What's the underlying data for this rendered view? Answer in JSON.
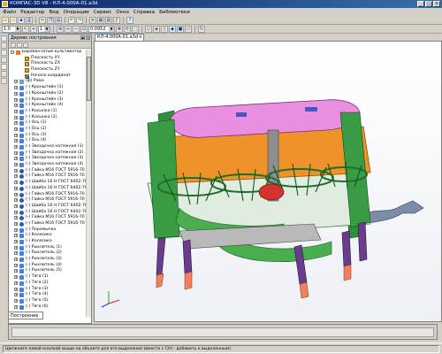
{
  "window": {
    "title": "КОМПАС-3D V8 - КЛ-4.000А-01.a3d"
  },
  "menu": [
    "Файл",
    "Редактор",
    "Вид",
    "Операции",
    "Сервис",
    "Окно",
    "Справка",
    "Библиотеки"
  ],
  "toolbar": {
    "zoom_value": "0.0952",
    "step_value": "1.0",
    "extra_value": "1"
  },
  "tree_panel": {
    "title": "Дерево построения",
    "tab_label": "Построение",
    "items": [
      "Барабанчатый культиватор",
      "Плоскость XY",
      "Плоскость ZX",
      "Плоскость ZY",
      "Начало координат",
      "(ф) Рама",
      "(-) Кронштейн (1)",
      "(-) Кронштейн (2)",
      "(-) Кронштейн (3)",
      "(-) Кронштейн (4)",
      "(-) Косынка (1)",
      "(-) Косынка (2)",
      "(-) Ось (1)",
      "(-) Ось (2)",
      "(-) Ось (3)",
      "(-) Ось (4)",
      "(-) Звездочка натяжная (1)",
      "(-) Звездочка натяжная (2)",
      "(-) Звездочка натяжная (3)",
      "(-) Звездочка натяжная (4)",
      "(-) Гайка М16 ГОСТ 5916-70",
      "(-) Гайка М16 ГОСТ 5916-70",
      "(-) Шайба 16 Н ГОСТ 6402-70",
      "(-) Шайба 16 Н ГОСТ 6402-70",
      "(-) Гайка М16 ГОСТ 5916-70",
      "(-) Гайка М16 ГОСТ 5916-70",
      "(-) Шайба 16 Н ГОСТ 6402-70",
      "(-) Шайба 16 Н ГОСТ 6402-70",
      "(-) Гайка М16 ГОСТ 5916-70",
      "(-) Гайка М16 ГОСТ 5916-70",
      "(-) Перемычка",
      "(-) Колесико",
      "(-) Колесико",
      "(-) Рыхлитель (1)",
      "(-) Рыхлитель (2)",
      "(-) Рыхлитель (3)",
      "(-) Рыхлитель (4)",
      "(-) Рыхлитель (5)",
      "(-) Тяга (1)",
      "(-) Тяга (2)",
      "(-) Тяга (3)",
      "(-) Тяга (4)",
      "(-) Тяга (5)",
      "(-) Тяга (6)"
    ]
  },
  "document_tab": {
    "label": "КЛ-4.000А-01.a3d"
  },
  "status": {
    "hint": "Щелкните левой кнопкой мыши на объекте для его выделения (вместе с Ctrl - добавить к выделенным)"
  },
  "colors": {
    "titlebar": "#0a246a",
    "chrome": "#d4d0c8",
    "frame": "#2f8f3a",
    "wheel": "#e88c1a",
    "top_plate": "#e88fe0",
    "shanks": "#6a3c8c",
    "tips": "#f08060"
  }
}
